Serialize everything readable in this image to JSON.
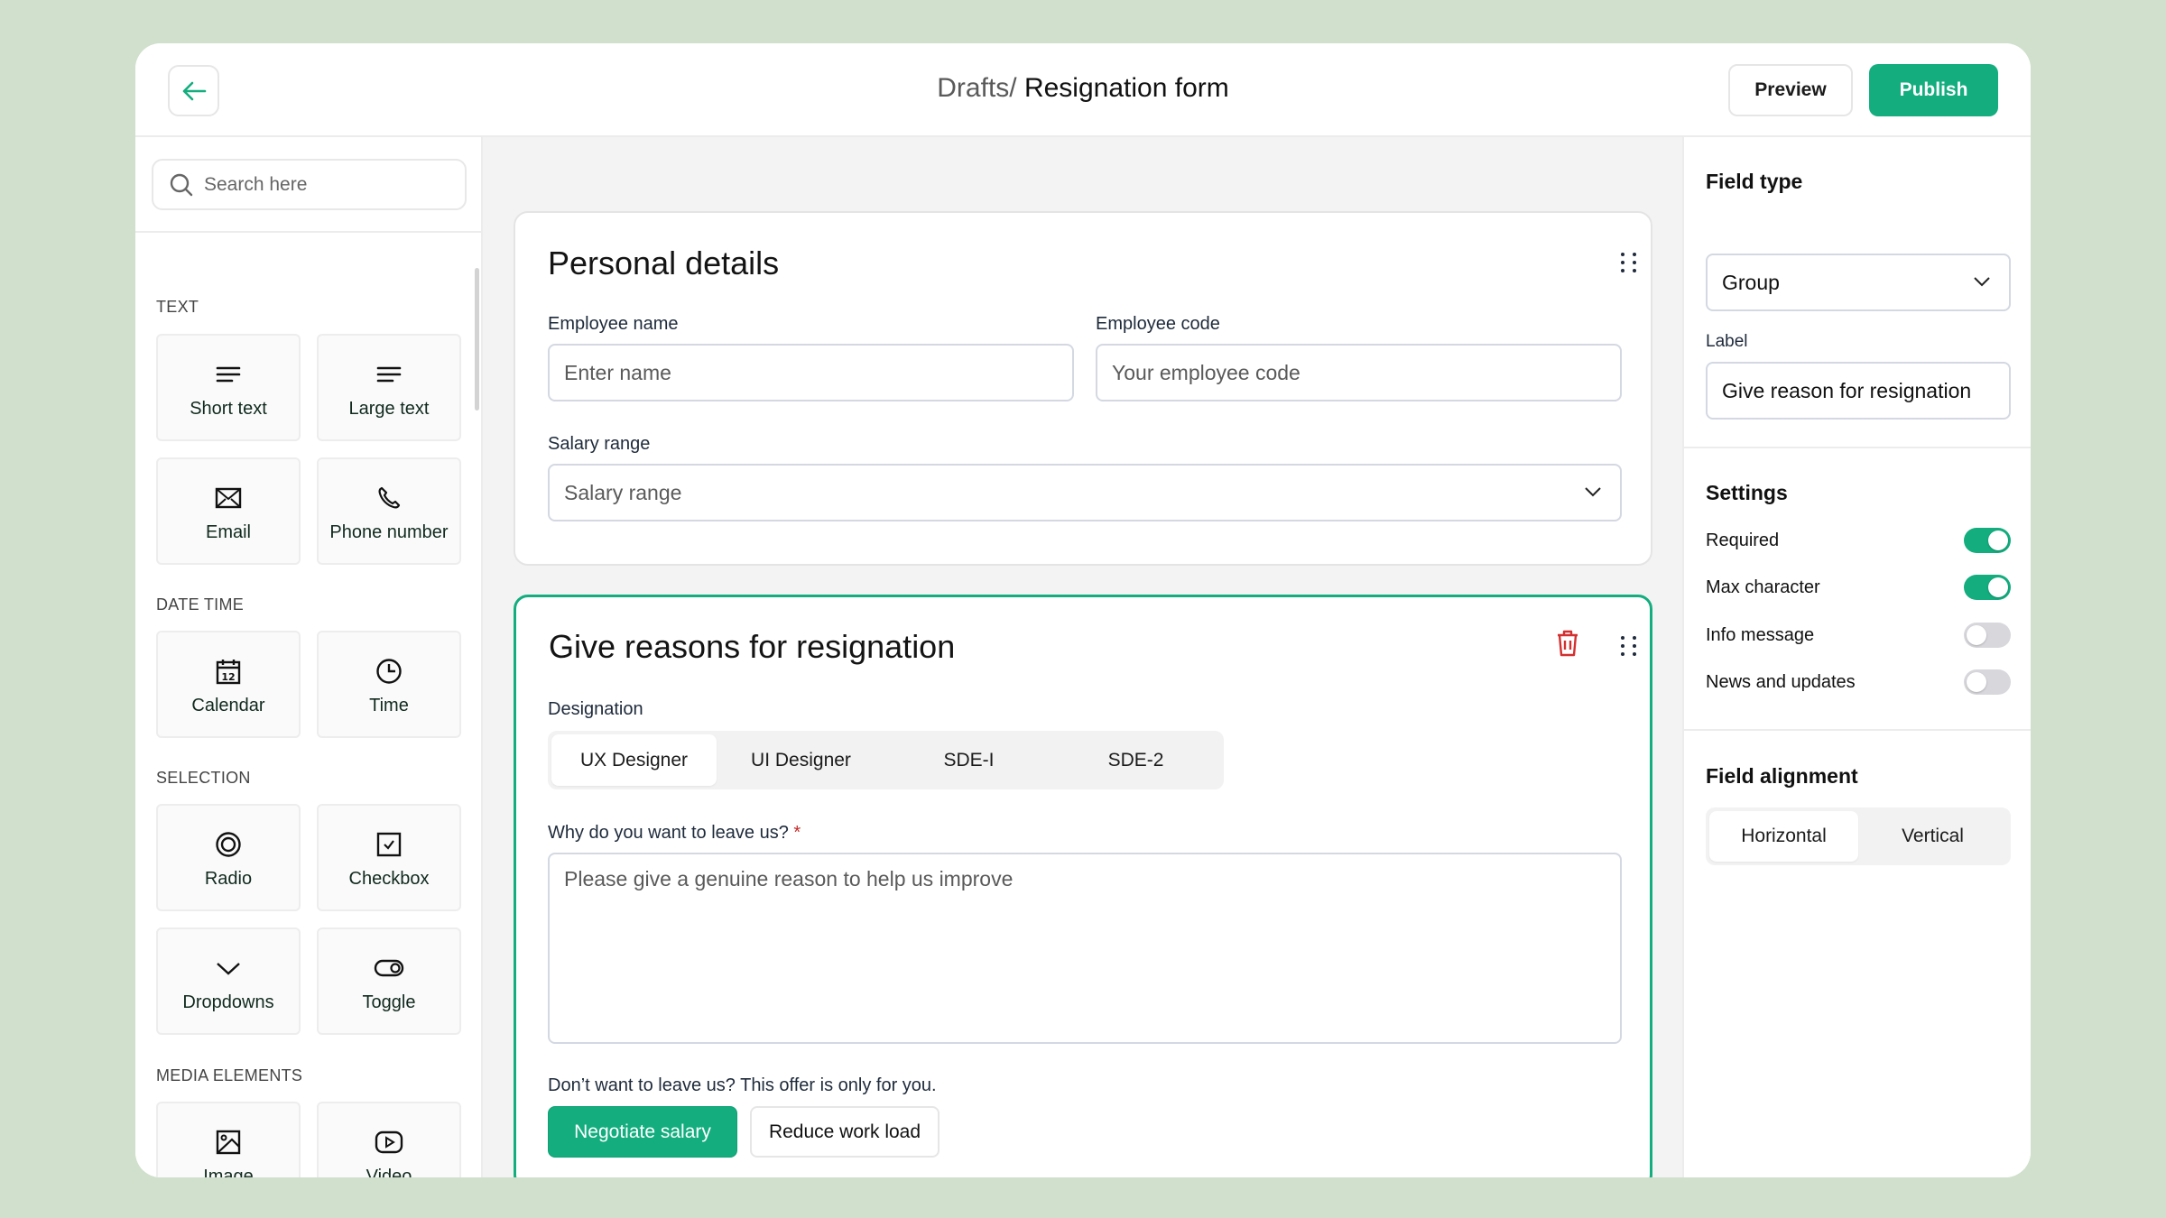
{
  "header": {
    "back_label": "Back",
    "breadcrumb_parent": "Drafts/",
    "breadcrumb_current": " Resignation form",
    "preview_label": "Preview",
    "publish_label": "Publish"
  },
  "sidebar": {
    "search_placeholder": "Search here",
    "sections": [
      {
        "title": "TEXT",
        "items": [
          {
            "label": "Short text",
            "icon": "short-text-icon"
          },
          {
            "label": "Large text",
            "icon": "large-text-icon"
          },
          {
            "label": "Email",
            "icon": "email-icon"
          },
          {
            "label": "Phone number",
            "icon": "phone-icon"
          }
        ]
      },
      {
        "title": "DATE TIME",
        "items": [
          {
            "label": "Calendar",
            "icon": "calendar-icon"
          },
          {
            "label": "Time",
            "icon": "clock-icon"
          }
        ]
      },
      {
        "title": "SELECTION",
        "items": [
          {
            "label": "Radio",
            "icon": "radio-icon"
          },
          {
            "label": "Checkbox",
            "icon": "checkbox-icon"
          },
          {
            "label": "Dropdowns",
            "icon": "chevron-down-icon"
          },
          {
            "label": "Toggle",
            "icon": "toggle-icon"
          }
        ]
      },
      {
        "title": "MEDIA ELEMENTS",
        "items": [
          {
            "label": "Image",
            "icon": "image-icon"
          },
          {
            "label": "Video",
            "icon": "video-icon"
          }
        ]
      }
    ]
  },
  "main": {
    "personal": {
      "title": "Personal details",
      "employee_name_label": "Employee name",
      "employee_name_placeholder": "Enter name",
      "employee_code_label": "Employee code",
      "employee_code_placeholder": "Your employee code",
      "salary_label": "Salary range",
      "salary_placeholder": "Salary range"
    },
    "reasons": {
      "title": "Give reasons for resignation",
      "designation_label": "Designation",
      "designations": [
        "UX Designer",
        "UI Designer",
        "SDE-I",
        "SDE-2"
      ],
      "designation_selected": "UX Designer",
      "why_label": "Why do you want to leave us?",
      "required_mark": "*",
      "why_placeholder": "Please give a genuine reason to help us improve",
      "offer_text": "Don’t want to leave us? This offer is only for you.",
      "negotiate_label": "Negotiate salary",
      "reduce_label": "Reduce work load"
    }
  },
  "panel": {
    "field_type_title": "Field type",
    "field_type_value": "Group",
    "label_title": "Label",
    "label_value": "Give reason for resignation",
    "settings_title": "Settings",
    "settings": [
      {
        "label": "Required",
        "on": true
      },
      {
        "label": "Max character",
        "on": true
      },
      {
        "label": "Info message",
        "on": false
      },
      {
        "label": "News and updates",
        "on": false
      }
    ],
    "alignment_title": "Field alignment",
    "alignment_options": [
      "Horizontal",
      "Vertical"
    ],
    "alignment_selected": "Horizontal"
  },
  "colors": {
    "accent": "#13ad7e",
    "background": "#d0e0cc",
    "danger": "#d32f2f"
  }
}
